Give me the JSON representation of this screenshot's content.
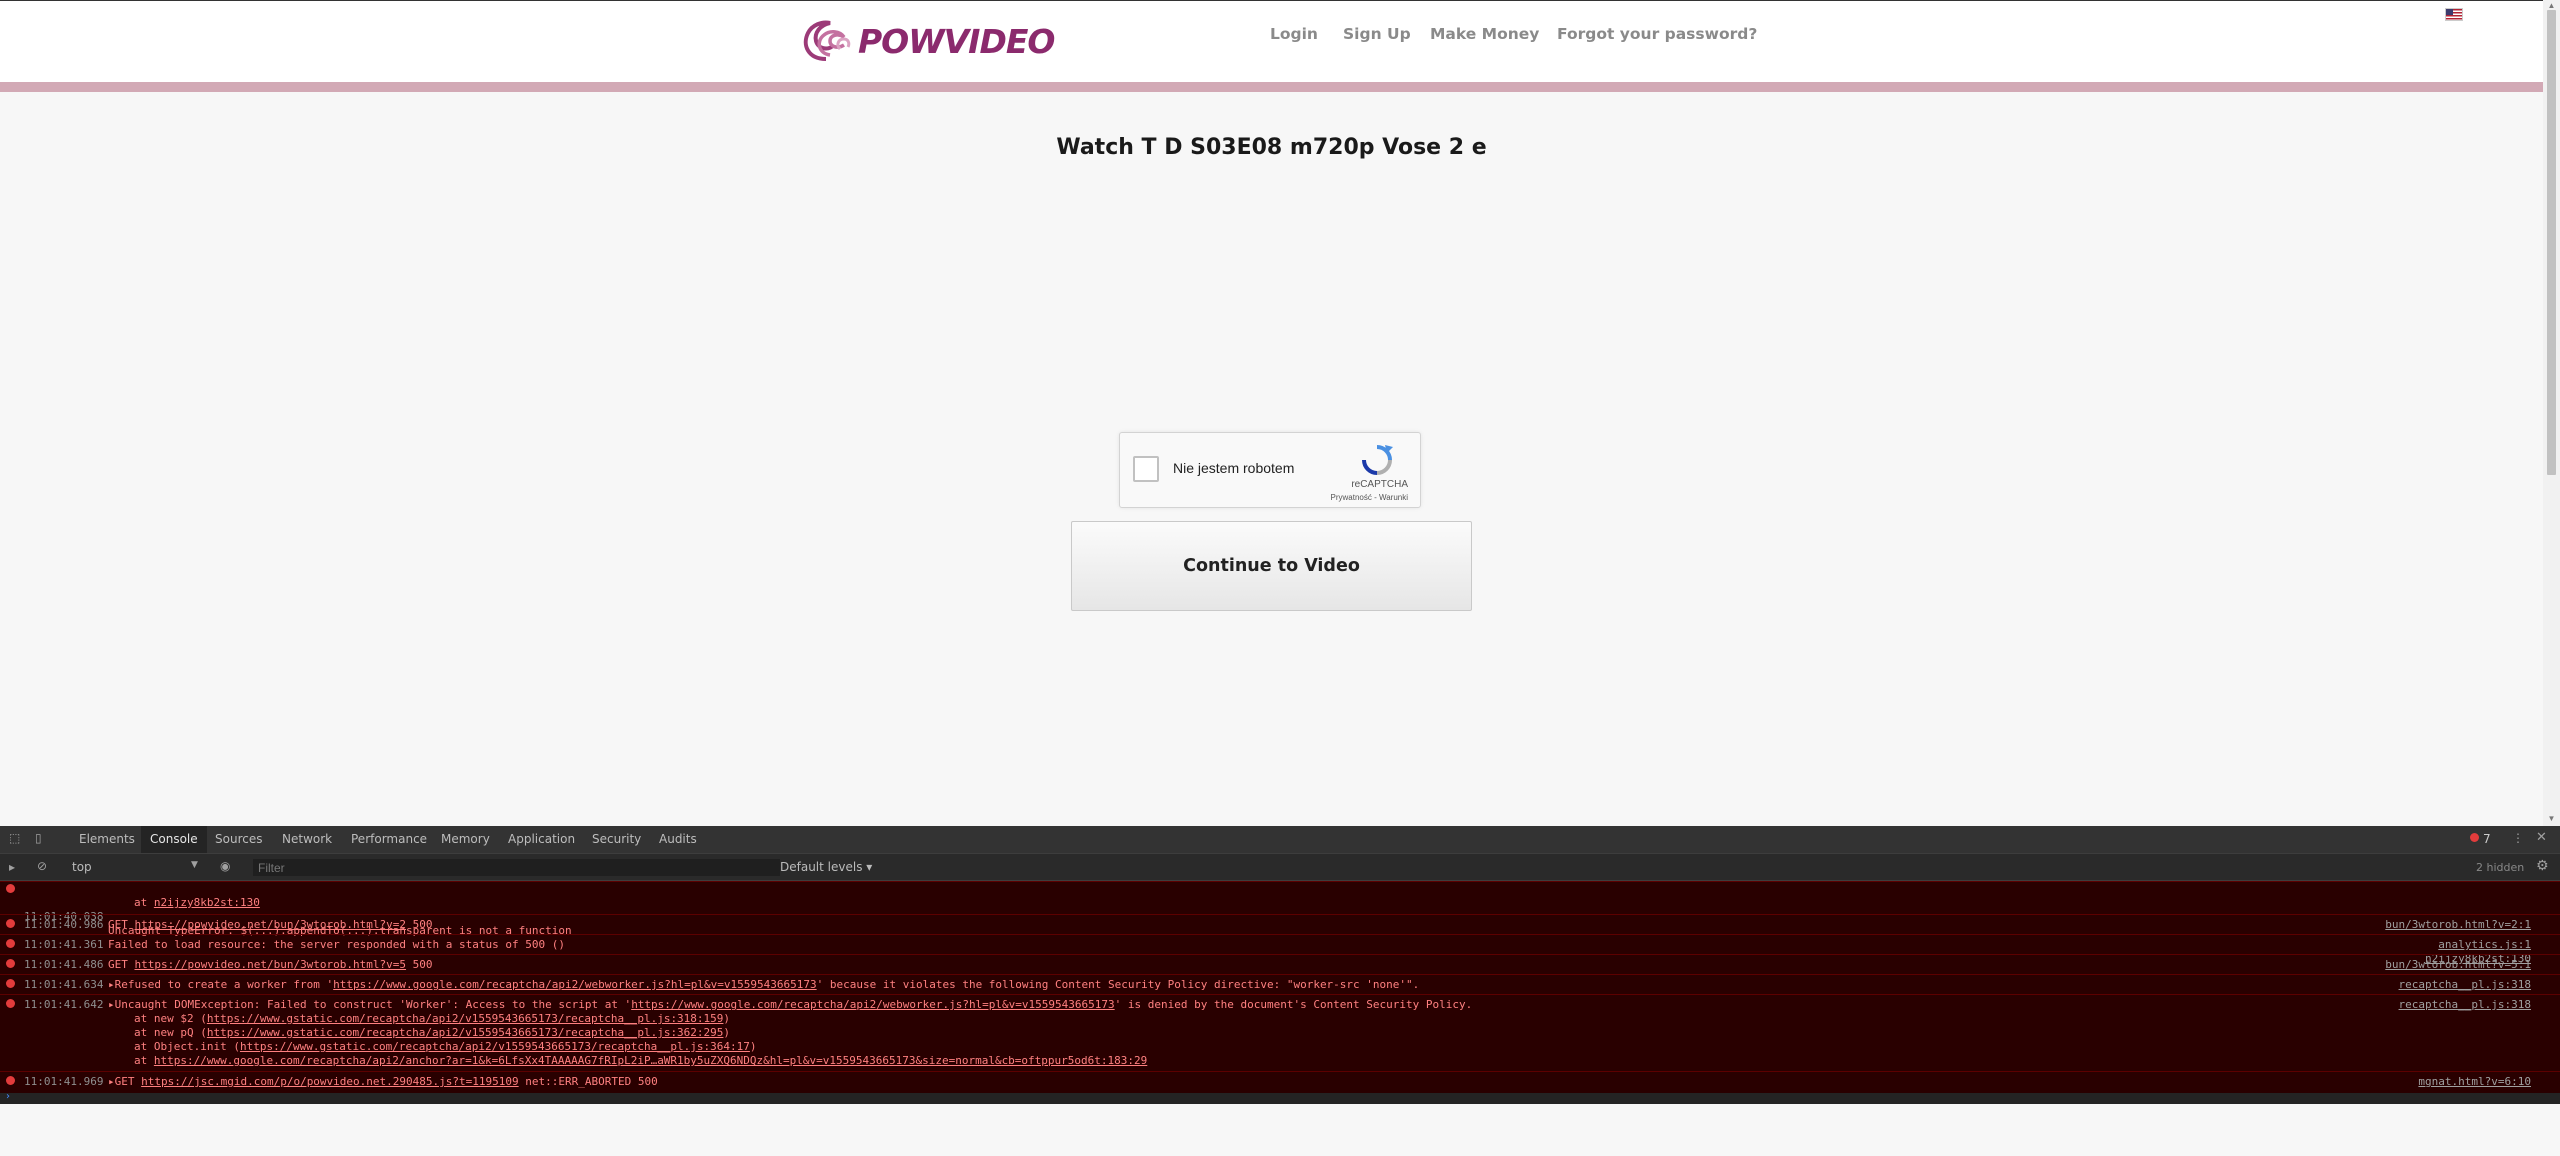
{
  "site": {
    "logo_text": "POWVIDEO",
    "nav": {
      "login": "Login",
      "signup": "Sign Up",
      "make_money": "Make Money",
      "forgot": "Forgot your password?"
    },
    "page_title": "Watch T D S03E08 m720p Vose 2 e",
    "captcha": {
      "label": "Nie jestem robotem",
      "brand": "reCAPTCHA",
      "links": "Prywatność - Warunki"
    },
    "continue_button": "Continue to Video"
  },
  "devtools": {
    "tabs": [
      "Elements",
      "Console",
      "Sources",
      "Network",
      "Performance",
      "Memory",
      "Application",
      "Security",
      "Audits"
    ],
    "active_tab": "Console",
    "error_count": "7",
    "context": "top",
    "filter_placeholder": "Filter",
    "levels": "Default levels ▾",
    "hidden": "2 hidden",
    "logs": [
      {
        "time": "11:01:40.038",
        "prefix": "Uncaught TypeError: $(...).appendTo(...).transparent is not a function",
        "cont1_pre": "at ",
        "cont1_link": "n2ijzy8kb2st:130",
        "source": "n2ijzy8kb2st:130"
      },
      {
        "time": "11:01:40.986",
        "pre": "GET ",
        "link": "https://powvideo.net/bun/3wtorob.html?v=2",
        "post": " 500",
        "source": "bun/3wtorob.html?v=2:1"
      },
      {
        "time": "11:01:41.361",
        "msg": "Failed to load resource: the server responded with a status of 500 ()",
        "source": "analytics.js:1"
      },
      {
        "time": "11:01:41.486",
        "pre": "GET ",
        "link": "https://powvideo.net/bun/3wtorob.html?v=5",
        "post": " 500",
        "source": "bun/3wtorob.html?v=5:1"
      },
      {
        "time": "11:01:41.634",
        "pre": "▸Refused to create a worker from '",
        "link": "https://www.google.com/recaptcha/api2/webworker.js?hl=pl&v=v1559543665173",
        "post": "' because it violates the following Content Security Policy directive: \"worker-src 'none'\".",
        "source": "recaptcha__pl.js:318"
      },
      {
        "time": "11:01:41.642",
        "pre": "▸Uncaught DOMException: Failed to construct 'Worker': Access to the script at '",
        "link": "https://www.google.com/recaptcha/api2/webworker.js?hl=pl&v=v1559543665173",
        "post": "' is denied by the document's Content Security Policy.",
        "stack": [
          {
            "pre": "at new $2 (",
            "link": "https://www.gstatic.com/recaptcha/api2/v1559543665173/recaptcha__pl.js:318:159",
            "post": ")"
          },
          {
            "pre": "at new pQ (",
            "link": "https://www.gstatic.com/recaptcha/api2/v1559543665173/recaptcha__pl.js:362:295",
            "post": ")"
          },
          {
            "pre": "at Object.init (",
            "link": "https://www.gstatic.com/recaptcha/api2/v1559543665173/recaptcha__pl.js:364:17",
            "post": ")"
          },
          {
            "pre": "at ",
            "link": "https://www.google.com/recaptcha/api2/anchor?ar=1&k=6LfsXx4TAAAAAG7fRIpL2iP…aWR1by5uZXQ6NDQz&hl=pl&v=v1559543665173&size=normal&cb=oftppur5od6t:183:29",
            "post": ""
          }
        ],
        "source": "recaptcha__pl.js:318"
      },
      {
        "time": "11:01:41.969",
        "pre": "▸GET ",
        "link": "https://jsc.mgid.com/p/o/powvideo.net.290485.js?t=1195109",
        "post": " net::ERR_ABORTED 500",
        "source": "mgnat.html?v=6:10"
      }
    ]
  }
}
